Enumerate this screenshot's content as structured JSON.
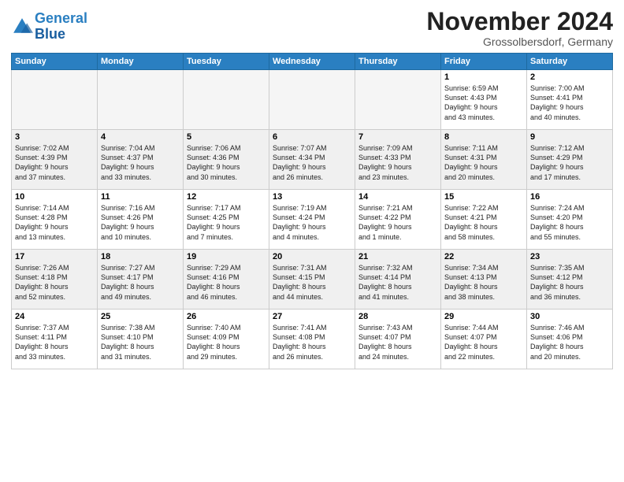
{
  "header": {
    "logo_line1": "General",
    "logo_line2": "Blue",
    "month_title": "November 2024",
    "location": "Grossolbersdorf, Germany"
  },
  "weekdays": [
    "Sunday",
    "Monday",
    "Tuesday",
    "Wednesday",
    "Thursday",
    "Friday",
    "Saturday"
  ],
  "weeks": [
    [
      {
        "day": "",
        "info": "",
        "empty": true
      },
      {
        "day": "",
        "info": "",
        "empty": true
      },
      {
        "day": "",
        "info": "",
        "empty": true
      },
      {
        "day": "",
        "info": "",
        "empty": true
      },
      {
        "day": "",
        "info": "",
        "empty": true
      },
      {
        "day": "1",
        "info": "Sunrise: 6:59 AM\nSunset: 4:43 PM\nDaylight: 9 hours\nand 43 minutes.",
        "empty": false
      },
      {
        "day": "2",
        "info": "Sunrise: 7:00 AM\nSunset: 4:41 PM\nDaylight: 9 hours\nand 40 minutes.",
        "empty": false
      }
    ],
    [
      {
        "day": "3",
        "info": "Sunrise: 7:02 AM\nSunset: 4:39 PM\nDaylight: 9 hours\nand 37 minutes.",
        "empty": false
      },
      {
        "day": "4",
        "info": "Sunrise: 7:04 AM\nSunset: 4:37 PM\nDaylight: 9 hours\nand 33 minutes.",
        "empty": false
      },
      {
        "day": "5",
        "info": "Sunrise: 7:06 AM\nSunset: 4:36 PM\nDaylight: 9 hours\nand 30 minutes.",
        "empty": false
      },
      {
        "day": "6",
        "info": "Sunrise: 7:07 AM\nSunset: 4:34 PM\nDaylight: 9 hours\nand 26 minutes.",
        "empty": false
      },
      {
        "day": "7",
        "info": "Sunrise: 7:09 AM\nSunset: 4:33 PM\nDaylight: 9 hours\nand 23 minutes.",
        "empty": false
      },
      {
        "day": "8",
        "info": "Sunrise: 7:11 AM\nSunset: 4:31 PM\nDaylight: 9 hours\nand 20 minutes.",
        "empty": false
      },
      {
        "day": "9",
        "info": "Sunrise: 7:12 AM\nSunset: 4:29 PM\nDaylight: 9 hours\nand 17 minutes.",
        "empty": false
      }
    ],
    [
      {
        "day": "10",
        "info": "Sunrise: 7:14 AM\nSunset: 4:28 PM\nDaylight: 9 hours\nand 13 minutes.",
        "empty": false
      },
      {
        "day": "11",
        "info": "Sunrise: 7:16 AM\nSunset: 4:26 PM\nDaylight: 9 hours\nand 10 minutes.",
        "empty": false
      },
      {
        "day": "12",
        "info": "Sunrise: 7:17 AM\nSunset: 4:25 PM\nDaylight: 9 hours\nand 7 minutes.",
        "empty": false
      },
      {
        "day": "13",
        "info": "Sunrise: 7:19 AM\nSunset: 4:24 PM\nDaylight: 9 hours\nand 4 minutes.",
        "empty": false
      },
      {
        "day": "14",
        "info": "Sunrise: 7:21 AM\nSunset: 4:22 PM\nDaylight: 9 hours\nand 1 minute.",
        "empty": false
      },
      {
        "day": "15",
        "info": "Sunrise: 7:22 AM\nSunset: 4:21 PM\nDaylight: 8 hours\nand 58 minutes.",
        "empty": false
      },
      {
        "day": "16",
        "info": "Sunrise: 7:24 AM\nSunset: 4:20 PM\nDaylight: 8 hours\nand 55 minutes.",
        "empty": false
      }
    ],
    [
      {
        "day": "17",
        "info": "Sunrise: 7:26 AM\nSunset: 4:18 PM\nDaylight: 8 hours\nand 52 minutes.",
        "empty": false
      },
      {
        "day": "18",
        "info": "Sunrise: 7:27 AM\nSunset: 4:17 PM\nDaylight: 8 hours\nand 49 minutes.",
        "empty": false
      },
      {
        "day": "19",
        "info": "Sunrise: 7:29 AM\nSunset: 4:16 PM\nDaylight: 8 hours\nand 46 minutes.",
        "empty": false
      },
      {
        "day": "20",
        "info": "Sunrise: 7:31 AM\nSunset: 4:15 PM\nDaylight: 8 hours\nand 44 minutes.",
        "empty": false
      },
      {
        "day": "21",
        "info": "Sunrise: 7:32 AM\nSunset: 4:14 PM\nDaylight: 8 hours\nand 41 minutes.",
        "empty": false
      },
      {
        "day": "22",
        "info": "Sunrise: 7:34 AM\nSunset: 4:13 PM\nDaylight: 8 hours\nand 38 minutes.",
        "empty": false
      },
      {
        "day": "23",
        "info": "Sunrise: 7:35 AM\nSunset: 4:12 PM\nDaylight: 8 hours\nand 36 minutes.",
        "empty": false
      }
    ],
    [
      {
        "day": "24",
        "info": "Sunrise: 7:37 AM\nSunset: 4:11 PM\nDaylight: 8 hours\nand 33 minutes.",
        "empty": false
      },
      {
        "day": "25",
        "info": "Sunrise: 7:38 AM\nSunset: 4:10 PM\nDaylight: 8 hours\nand 31 minutes.",
        "empty": false
      },
      {
        "day": "26",
        "info": "Sunrise: 7:40 AM\nSunset: 4:09 PM\nDaylight: 8 hours\nand 29 minutes.",
        "empty": false
      },
      {
        "day": "27",
        "info": "Sunrise: 7:41 AM\nSunset: 4:08 PM\nDaylight: 8 hours\nand 26 minutes.",
        "empty": false
      },
      {
        "day": "28",
        "info": "Sunrise: 7:43 AM\nSunset: 4:07 PM\nDaylight: 8 hours\nand 24 minutes.",
        "empty": false
      },
      {
        "day": "29",
        "info": "Sunrise: 7:44 AM\nSunset: 4:07 PM\nDaylight: 8 hours\nand 22 minutes.",
        "empty": false
      },
      {
        "day": "30",
        "info": "Sunrise: 7:46 AM\nSunset: 4:06 PM\nDaylight: 8 hours\nand 20 minutes.",
        "empty": false
      }
    ]
  ]
}
